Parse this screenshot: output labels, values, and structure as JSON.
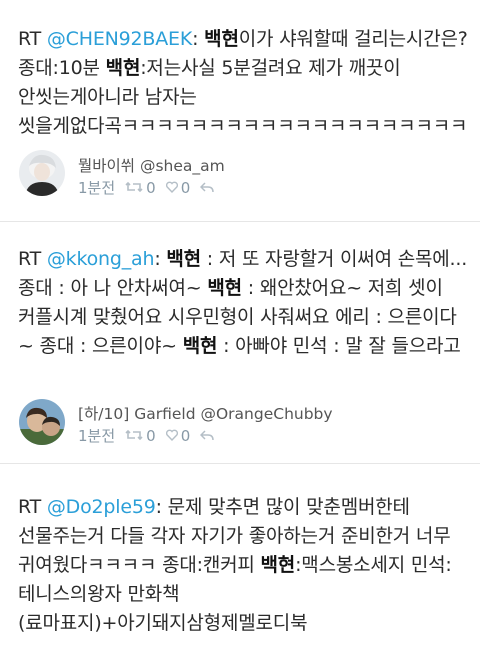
{
  "tweets": [
    {
      "prefix": "RT ",
      "mention": "@CHEN92BAEK",
      "segments": [
        {
          "t": ": "
        },
        {
          "b": "백현"
        },
        {
          "t": "이가 샤워할때 걸리는시간은? 종대:10분 "
        },
        {
          "b": "백현"
        },
        {
          "t": ":저는사실 5분걸려요 제가 깨끗이 안씻는게아니라 남자는 씻을게없다곡ㅋㅋㅋㅋㅋㅋㅋㅋㅋㅋㅋㅋㅋㅋㅋㅋㅋㅋㅋㅋ"
        }
      ],
      "author": "뭘바이쒸 @shea_am",
      "time": "1분전",
      "retweet_count": "0",
      "like_count": "0",
      "icons": {
        "retweet": "retweet-icon",
        "like": "heart-icon",
        "reply": "reply-icon"
      }
    },
    {
      "prefix": "RT ",
      "mention": "@kkong_ah",
      "segments": [
        {
          "t": ": "
        },
        {
          "b": "백현"
        },
        {
          "t": " : 저 또 자랑할거 이써여 손목에... 종대 : 아 나 안차써여~ "
        },
        {
          "b": "백현"
        },
        {
          "t": " : 왜안찼어요~ 저희 셋이 커플시계 맞췄어요 시우민형이 사줘써요 에리 : 으른이다~ 종대 : 으른이야~ "
        },
        {
          "b": "백현"
        },
        {
          "t": " : 아빠야 민석 : 말 잘 들으라고"
        }
      ],
      "author": "[하/10] Garfield @OrangeChubby",
      "time": "1분전",
      "retweet_count": "0",
      "like_count": "0",
      "icons": {
        "retweet": "retweet-icon",
        "like": "heart-icon",
        "reply": "reply-icon"
      }
    },
    {
      "prefix": "RT ",
      "mention": "@Do2ple59",
      "segments": [
        {
          "t": ": 문제 맞추면 많이 맞춘멤버한테 선물주는거 다들 각자 자기가 좋아하는거 준비한거 너무 귀여웠다ㅋㅋㅋㅋ 종대:캔커피 "
        },
        {
          "b": "백현"
        },
        {
          "t": ":맥스봉소세지 민석:테니스의왕자 만화책(료마표지)+아기돼지삼형제멜로디북"
        }
      ]
    }
  ],
  "colors": {
    "mention": "#2b9fd8",
    "meta": "#8899a6",
    "divider": "#e6e6e6"
  }
}
